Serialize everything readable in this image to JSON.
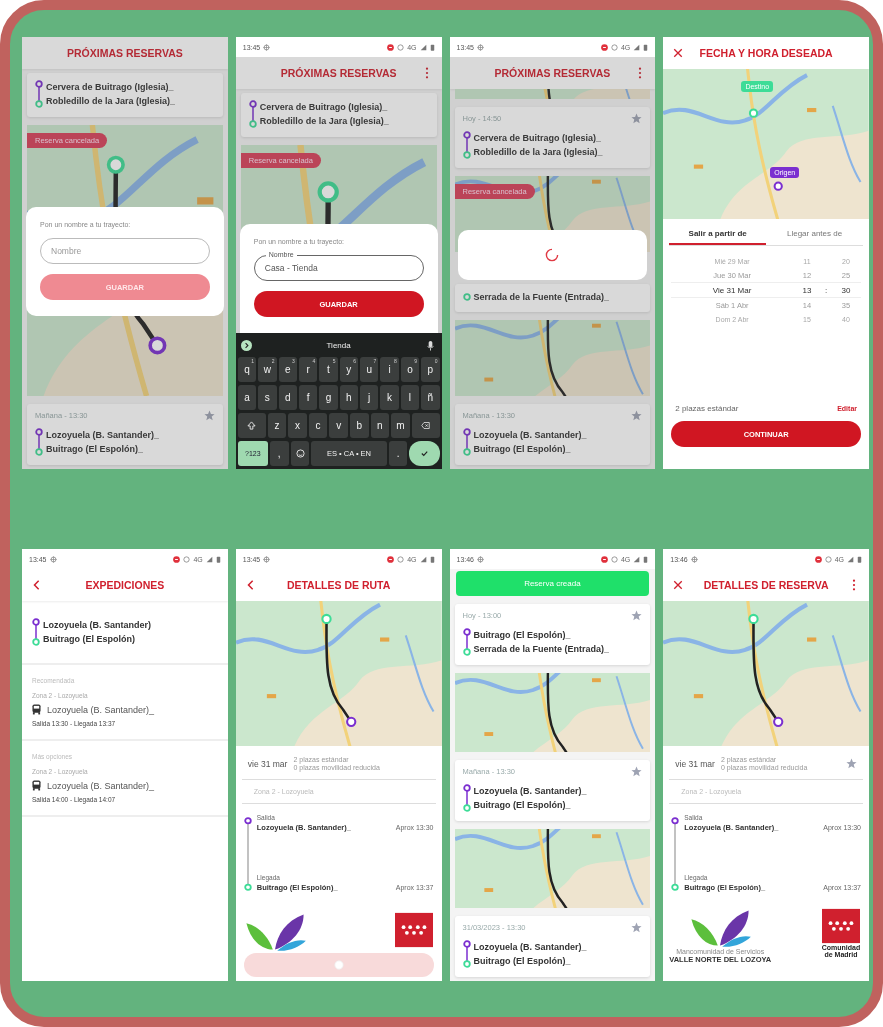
{
  "screens": [
    {
      "kind": "list",
      "header": {
        "title": "PRÓXIMAS RESERVAS"
      },
      "dimmed": true,
      "blocks": [
        {
          "kind": "trip",
          "from": "Cervera de Buitrago (Iglesia)_",
          "to": "Robledillo de la Jara (Iglesia)_"
        },
        {
          "kind": "map",
          "badge": "Reserva cancelada"
        },
        {
          "kind": "trip",
          "time": "Mañana - 13:30",
          "from": "Lozoyuela (B. Santander)_",
          "to": "Buitrago (El Espolón)_"
        }
      ],
      "dialog": {
        "prompt": "Pon un nombre a tu trayecto:",
        "field": {
          "placeholder": "Nombre"
        },
        "button": {
          "label": "GUARDAR",
          "disabled": true
        }
      }
    },
    {
      "kind": "list",
      "status": {
        "time": "13:45",
        "network": "4G"
      },
      "header": {
        "title": "PRÓXIMAS RESERVAS",
        "menu": true
      },
      "dimmed": true,
      "blocks": [
        {
          "kind": "trip",
          "from": "Cervera de Buitrago (Iglesia)_",
          "to": "Robledillo de la Jara (Iglesia)_"
        },
        {
          "kind": "map",
          "badge": "Reserva cancelada"
        }
      ],
      "dialog": {
        "prompt": "Pon un nombre a tu trayecto:",
        "field": {
          "label": "Nombre",
          "value": "Casa - Tienda"
        },
        "button": {
          "label": "GUARDAR",
          "disabled": false
        }
      },
      "keyboard": {
        "suggestion": "Tienda",
        "rows": [
          {
            "keys": [
              {
                "kind": "letter",
                "label": "q",
                "hint": "1"
              },
              {
                "kind": "letter",
                "label": "w",
                "hint": "2"
              },
              {
                "kind": "letter",
                "label": "e",
                "hint": "3"
              },
              {
                "kind": "letter",
                "label": "r",
                "hint": "4"
              },
              {
                "kind": "letter",
                "label": "t",
                "hint": "5"
              },
              {
                "kind": "letter",
                "label": "y",
                "hint": "6"
              },
              {
                "kind": "letter",
                "label": "u",
                "hint": "7"
              },
              {
                "kind": "letter",
                "label": "i",
                "hint": "8"
              },
              {
                "kind": "letter",
                "label": "o",
                "hint": "9"
              },
              {
                "kind": "letter",
                "label": "p",
                "hint": "0"
              }
            ]
          },
          {
            "keys": [
              {
                "kind": "letter",
                "label": "a"
              },
              {
                "kind": "letter",
                "label": "s"
              },
              {
                "kind": "letter",
                "label": "d"
              },
              {
                "kind": "letter",
                "label": "f"
              },
              {
                "kind": "letter",
                "label": "g"
              },
              {
                "kind": "letter",
                "label": "h"
              },
              {
                "kind": "letter",
                "label": "j"
              },
              {
                "kind": "letter",
                "label": "k"
              },
              {
                "kind": "letter",
                "label": "l"
              },
              {
                "kind": "letter",
                "label": "ñ"
              }
            ]
          },
          {
            "keys": [
              {
                "kind": "shift"
              },
              {
                "kind": "letter",
                "label": "z"
              },
              {
                "kind": "letter",
                "label": "x"
              },
              {
                "kind": "letter",
                "label": "c"
              },
              {
                "kind": "letter",
                "label": "v"
              },
              {
                "kind": "letter",
                "label": "b"
              },
              {
                "kind": "letter",
                "label": "n"
              },
              {
                "kind": "letter",
                "label": "m"
              },
              {
                "kind": "backspace"
              }
            ]
          },
          {
            "keys": [
              {
                "kind": "symbol",
                "label": "?123"
              },
              {
                "kind": "letter",
                "label": ","
              },
              {
                "kind": "emoji"
              },
              {
                "kind": "space",
                "label": "ES • CA • EN"
              },
              {
                "kind": "letter",
                "label": "."
              },
              {
                "kind": "enter"
              }
            ]
          }
        ]
      }
    },
    {
      "kind": "list",
      "status": {
        "time": "13:45",
        "network": "4G"
      },
      "header": {
        "title": "PRÓXIMAS RESERVAS",
        "menu": true
      },
      "dimmed": true,
      "blocks": [
        {
          "kind": "map_edge"
        },
        {
          "kind": "trip",
          "time": "Hoy - 14:50",
          "from": "Cervera de Buitrago (Iglesia)_",
          "to": "Robledillo de la Jara (Iglesia)_"
        },
        {
          "kind": "map",
          "badge": "Reserva cancelada"
        },
        {
          "kind": "loading"
        },
        {
          "kind": "trip",
          "to": "Serrada de la Fuente (Entrada)_"
        },
        {
          "kind": "map"
        },
        {
          "kind": "trip",
          "time": "Mañana - 13:30",
          "from": "Lozoyuela (B. Santander)_",
          "to": "Buitrago (El Espolón)_"
        }
      ]
    },
    {
      "kind": "datetime",
      "header": {
        "title": "FECHA Y HORA DESEADA",
        "close": true
      },
      "pins": [
        {
          "label": "Destino",
          "color": "#3ddc97"
        },
        {
          "label": "Origen",
          "color": "#7b2fd0"
        }
      ],
      "tabs": [
        {
          "label": "Salir a partir de",
          "selected": true
        },
        {
          "label": "Llegar antes de",
          "selected": false
        }
      ],
      "picker": [
        {
          "date": "Mié 29 Mar",
          "hour": "11",
          "minute": "20",
          "selected": false
        },
        {
          "date": "Jue 30 Mar",
          "hour": "12",
          "minute": "25",
          "selected": false
        },
        {
          "date": "Vie 31 Mar",
          "hour": "13",
          "minute": "30",
          "selected": true
        },
        {
          "date": "Sáb 1 Abr",
          "hour": "14",
          "minute": "35",
          "selected": false
        },
        {
          "date": "Dom 2 Abr",
          "hour": "15",
          "minute": "40",
          "selected": false
        }
      ],
      "separator": ":",
      "seats": "2 plazas estándar",
      "edit": "Editar",
      "button": "CONTINUAR"
    },
    {
      "kind": "expeditions",
      "status": {
        "time": "13:45",
        "network": "4G"
      },
      "header": {
        "title": "EXPEDICIONES",
        "back": true
      },
      "route": {
        "from": "Lozoyuela (B. Santander)",
        "to": "Buitrago (El Espolón)"
      },
      "sections": [
        {
          "label": "Recomendada",
          "zone": "Zona 2 - Lozoyuela",
          "stop": "Lozoyuela (B. Santander)_",
          "times": "Salida 13:30 - Llegada 13:37"
        },
        {
          "label": "Más opciones",
          "zone": "Zona 2 - Lozoyuela",
          "stop": "Lozoyuela (B. Santander)_",
          "times": "Salida 14:00 - Llegada 14:07"
        }
      ]
    },
    {
      "kind": "details",
      "status": {
        "time": "13:45",
        "network": "4G"
      },
      "header": {
        "title": "DETALLES DE RUTA",
        "back": true
      },
      "date": "vie 31 mar",
      "seats": [
        "2 plazas estándar",
        "0 plazas movilidad reducida"
      ],
      "zone": "Zona 2 - Lozoyuela",
      "stops": [
        {
          "label": "Salida",
          "name": "Lozoyuela (B. Santander)_",
          "time": "Aprox 13:30"
        },
        {
          "label": "Llegada",
          "name": "Buitrago (El Espolón)_",
          "time": "Aprox 13:37"
        }
      ],
      "logos": {
        "kind": "partial"
      },
      "footer_button": {
        "busy": true
      }
    },
    {
      "kind": "list",
      "status": {
        "time": "13:46",
        "network": "4G"
      },
      "toast": "Reserva creada",
      "blocks": [
        {
          "kind": "trip",
          "time": "Hoy - 13:00",
          "from": "Buitrago (El Espolón)_",
          "to": "Serrada de la Fuente (Entrada)_"
        },
        {
          "kind": "map"
        },
        {
          "kind": "trip",
          "time": "Mañana - 13:30",
          "from": "Lozoyuela (B. Santander)_",
          "to": "Buitrago (El Espolón)_"
        },
        {
          "kind": "map"
        },
        {
          "kind": "trip",
          "time": "31/03/2023 - 13:30",
          "from": "Lozoyuela (B. Santander)_",
          "to": "Buitrago (El Espolón)_"
        }
      ]
    },
    {
      "kind": "details",
      "status": {
        "time": "13:46",
        "network": "4G"
      },
      "header": {
        "title": "DETALLES DE RESERVA",
        "close": true,
        "menu": true
      },
      "date": "vie 31 mar",
      "seats": [
        "2 plazas estándar",
        "0 plazas movilidad reducida"
      ],
      "star": true,
      "zone": "Zona 2 - Lozoyuela",
      "stops": [
        {
          "label": "Salida",
          "name": "Lozoyuela (B. Santander)_",
          "time": "Aprox 13:30"
        },
        {
          "label": "Llegada",
          "name": "Buitrago (El Espolón)_",
          "time": "Aprox 13:37"
        }
      ],
      "logos": {
        "kind": "full",
        "left_caption": "Mancomunidad de Servicios",
        "left_title": "VALLE NORTE DEL LOZOYA",
        "right_caption": "Comunidad de Madrid"
      }
    }
  ]
}
